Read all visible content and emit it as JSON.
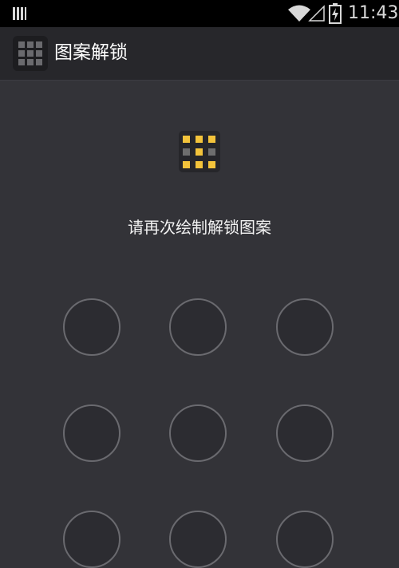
{
  "status_bar": {
    "time": "11:43",
    "icons": [
      "sim-icon",
      "wifi-icon",
      "signal-icon",
      "battery-charging-icon"
    ]
  },
  "action_bar": {
    "title": "图案解锁",
    "icon": "grid-icon"
  },
  "pattern_preview": {
    "icon": "pattern-preview-icon",
    "highlighted_color": "#f3c33b",
    "dim_color": "#6e6e6e"
  },
  "prompt": "请再次绘制解锁图案",
  "pattern_grid": {
    "rows": 3,
    "cols": 3
  },
  "colors": {
    "background": "#333338",
    "action_bar": "#27272b",
    "status_bar": "#000000",
    "accent": "#f3c33b"
  }
}
